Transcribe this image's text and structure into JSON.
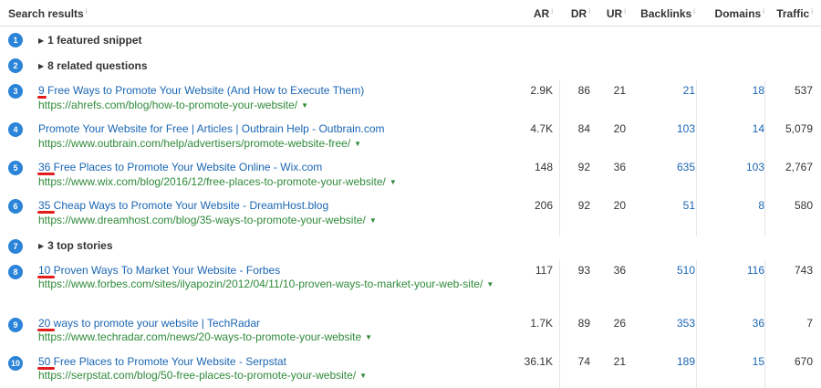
{
  "header": {
    "search_results": "Search results",
    "ar": "AR",
    "dr": "DR",
    "ur": "UR",
    "backlinks": "Backlinks",
    "domains": "Domains",
    "traffic": "Traffic",
    "info_glyph": "i"
  },
  "features": [
    {
      "num": "1",
      "label": "1 featured snippet"
    },
    {
      "num": "2",
      "label": "8 related questions"
    },
    {
      "num": "7",
      "label": "3 top stories"
    }
  ],
  "results": [
    {
      "num": "3",
      "title": "9 Free Ways to Promote Your Website (And How to Execute Them)",
      "url": "https://ahrefs.com/blog/how-to-promote-your-website/",
      "ar": "2.9K",
      "dr": "86",
      "ur": "21",
      "backlinks": "21",
      "domains": "18",
      "traffic": "537"
    },
    {
      "num": "4",
      "title": "Promote Your Website for Free | Articles | Outbrain Help - Outbrain.com",
      "url": "https://www.outbrain.com/help/advertisers/promote-website-free/",
      "ar": "4.7K",
      "dr": "84",
      "ur": "20",
      "backlinks": "103",
      "domains": "14",
      "traffic": "5,079"
    },
    {
      "num": "5",
      "title": "36 Free Places to Promote Your Website Online - Wix.com",
      "url": "https://www.wix.com/blog/2016/12/free-places-to-promote-your-website/",
      "ar": "148",
      "dr": "92",
      "ur": "36",
      "backlinks": "635",
      "domains": "103",
      "traffic": "2,767"
    },
    {
      "num": "6",
      "title": "35 Cheap Ways to Promote Your Website - DreamHost.blog",
      "url": "https://www.dreamhost.com/blog/35-ways-to-promote-your-website/",
      "ar": "206",
      "dr": "92",
      "ur": "20",
      "backlinks": "51",
      "domains": "8",
      "traffic": "580"
    },
    {
      "num": "8",
      "title": "10 Proven Ways To Market Your Website - Forbes",
      "url": "https://www.forbes.com/sites/ilyapozin/2012/04/11/10-proven-ways-to-market-your-web-site/",
      "ar": "117",
      "dr": "93",
      "ur": "36",
      "backlinks": "510",
      "domains": "116",
      "traffic": "743"
    },
    {
      "num": "9",
      "title": "20 ways to promote your website | TechRadar",
      "url": "https://www.techradar.com/news/20-ways-to-promote-your-website",
      "ar": "1.7K",
      "dr": "89",
      "ur": "26",
      "backlinks": "353",
      "domains": "36",
      "traffic": "7"
    },
    {
      "num": "10",
      "title": "50 Free Places to Promote Your Website - Serpstat",
      "url": "https://serpstat.com/blog/50-free-places-to-promote-your-website/",
      "ar": "36.1K",
      "dr": "74",
      "ur": "21",
      "backlinks": "189",
      "domains": "15",
      "traffic": "670"
    }
  ],
  "glyphs": {
    "expand": "▶",
    "dropdown": "▼"
  },
  "colors": {
    "badge": "#2b84d8",
    "link": "#1a66b3",
    "url": "#2f8a3a",
    "highlight": "#e31b1b",
    "text": "#333333"
  }
}
